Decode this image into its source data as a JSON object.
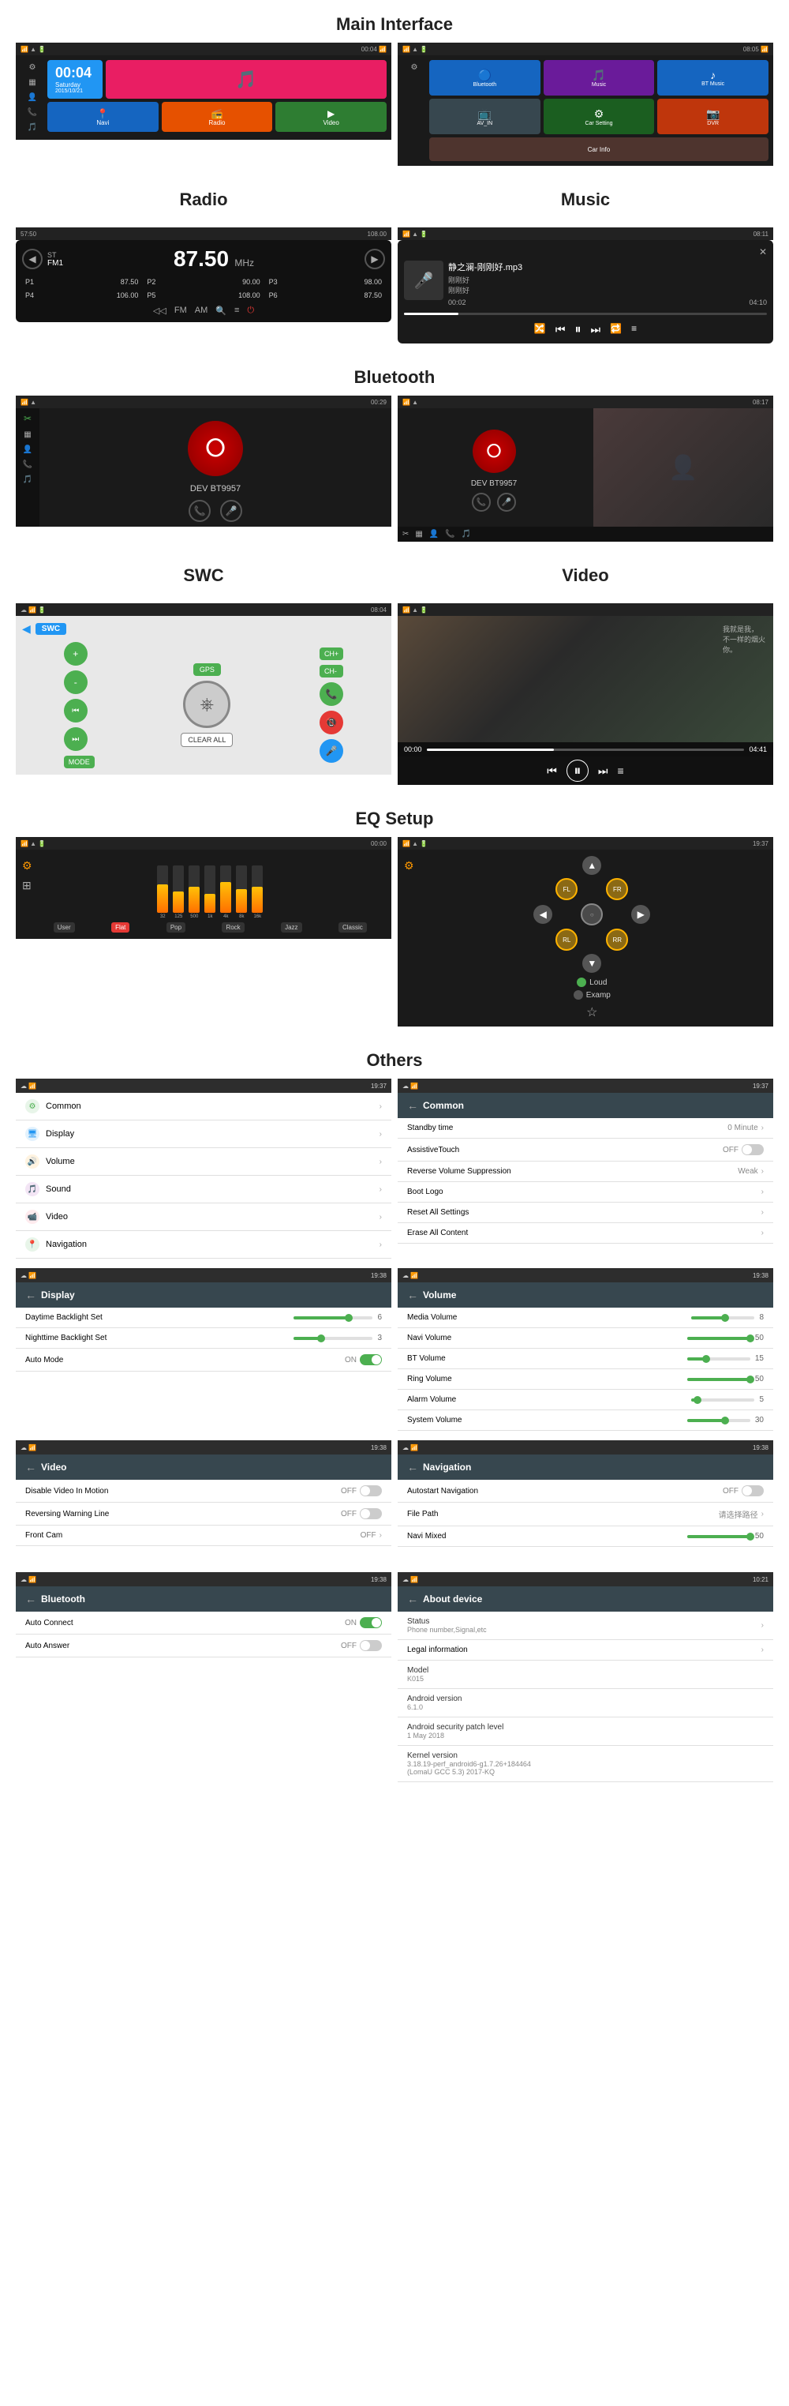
{
  "page": {
    "sections": [
      {
        "id": "main-interface",
        "title": "Main Interface"
      },
      {
        "id": "radio-music",
        "title1": "Radio",
        "title2": "Music"
      },
      {
        "id": "bluetooth",
        "title": "Bluetooth"
      },
      {
        "id": "swc-video",
        "title1": "SWC",
        "title2": "Video"
      },
      {
        "id": "eq-setup",
        "title": "EQ Setup"
      },
      {
        "id": "others",
        "title": "Others"
      }
    ]
  },
  "mainInterface": {
    "left": {
      "time": "00:04",
      "day": "Saturday",
      "date": "2015/10/21",
      "tiles": [
        {
          "label": "Navi",
          "color": "#1565C0",
          "icon": "📍"
        },
        {
          "label": "Radio",
          "color": "#E65100",
          "icon": "📻"
        },
        {
          "label": "",
          "color": "#6A1B9A",
          "icon": "🎵"
        },
        {
          "label": "Video",
          "color": "#2E7D32",
          "icon": "▶"
        }
      ]
    },
    "right": {
      "tiles": [
        {
          "label": "Bluetooth",
          "color": "#1565C0",
          "icon": "🔵"
        },
        {
          "label": "Music",
          "color": "#6A1B9A",
          "icon": "🎵"
        },
        {
          "label": "BT Music",
          "color": "#1565C0",
          "icon": "♪"
        },
        {
          "label": "AV_IN",
          "color": "#37474F",
          "icon": "📺"
        },
        {
          "label": "Car Setting",
          "color": "#1B5E20",
          "icon": "⚙"
        },
        {
          "label": "DVR",
          "color": "#BF360C",
          "icon": "📷"
        },
        {
          "label": "Car Info",
          "color": "#4E342E",
          "icon": "ℹ"
        }
      ]
    }
  },
  "radio": {
    "mode": "ST",
    "tuner": "FM1",
    "frequency": "87.50",
    "unit": "MHz",
    "range": "108.00",
    "presets": [
      {
        "slot": "P1",
        "freq": "87.50"
      },
      {
        "slot": "P2",
        "freq": "90.00"
      },
      {
        "slot": "P3",
        "freq": "98.00"
      },
      {
        "slot": "P4",
        "freq": "106.00"
      },
      {
        "slot": "P5",
        "freq": "108.00"
      },
      {
        "slot": "P6",
        "freq": "87.50"
      }
    ],
    "modes": [
      "FM",
      "AM",
      "Q",
      "EQ"
    ]
  },
  "music": {
    "title": "静之澜-刚刚好.mp3",
    "artist": "刚刚好",
    "album": "刚刚好",
    "timeElapsed": "00:02",
    "timeTotal": "04:10",
    "icon": "🎤"
  },
  "bluetooth": {
    "left": {
      "device": "DEV BT9957",
      "status": "Connected"
    },
    "right": {
      "device": "DEV BT9957",
      "status": "Connected"
    }
  },
  "swc": {
    "title": "SWC",
    "gpsLabel": "GPS",
    "clearAllLabel": "CLEAR ALL",
    "channelUp": "CH+",
    "channelDown": "CH-",
    "modeLabel": "MODE"
  },
  "video": {
    "timeElapsed": "00:00",
    "timeTotal": "04:41"
  },
  "eq": {
    "bars": [
      {
        "label": "32",
        "height": 60
      },
      {
        "label": "125",
        "height": 45
      },
      {
        "label": "500",
        "height": 55
      },
      {
        "label": "1k",
        "height": 40
      },
      {
        "label": "4k",
        "height": 65
      },
      {
        "label": "8k",
        "height": 50
      },
      {
        "label": "16k",
        "height": 55
      }
    ],
    "presets": [
      "User",
      "Flat",
      "Pop",
      "Rock",
      "Jazz",
      "Classic"
    ],
    "activePreset": "Flat",
    "rightOptions": [
      {
        "label": "Loud",
        "active": true
      },
      {
        "label": "Examp",
        "active": false
      }
    ]
  },
  "settings": {
    "mainItems": [
      {
        "icon": "⚙",
        "iconColor": "#4CAF50",
        "label": "Common"
      },
      {
        "icon": "🖥",
        "iconColor": "#2196F3",
        "label": "Display"
      },
      {
        "icon": "🔊",
        "iconColor": "#FF9800",
        "label": "Volume"
      },
      {
        "icon": "🎵",
        "iconColor": "#9C27B0",
        "label": "Sound"
      },
      {
        "icon": "📹",
        "iconColor": "#F44336",
        "label": "Video"
      },
      {
        "icon": "📍",
        "iconColor": "#4CAF50",
        "label": "Navigation"
      }
    ],
    "common": {
      "title": "Common",
      "items": [
        {
          "label": "Standby time",
          "value": "0 Minute",
          "type": "value-arrow"
        },
        {
          "label": "AssistiveTouch",
          "value": "OFF",
          "type": "toggle-off"
        },
        {
          "label": "Reverse Volume Suppression",
          "value": "Weak",
          "type": "value-arrow"
        },
        {
          "label": "Boot Logo",
          "value": "",
          "type": "arrow"
        },
        {
          "label": "Reset All Settings",
          "value": "",
          "type": "arrow"
        },
        {
          "label": "Erase All Content",
          "value": "",
          "type": "arrow"
        }
      ]
    },
    "display": {
      "title": "Display",
      "items": [
        {
          "label": "Daytime Backlight Set",
          "value": "6",
          "sliderPercent": 70,
          "type": "slider"
        },
        {
          "label": "Nighttime Backlight Set",
          "value": "3",
          "sliderPercent": 35,
          "type": "slider"
        },
        {
          "label": "Auto Mode",
          "value": "ON",
          "type": "toggle-on"
        }
      ]
    },
    "volume": {
      "title": "Volume",
      "items": [
        {
          "label": "Media Volume",
          "value": "8",
          "sliderPercent": 53,
          "type": "slider"
        },
        {
          "label": "Navi Volume",
          "value": "50",
          "sliderPercent": 100,
          "type": "slider"
        },
        {
          "label": "BT Volume",
          "value": "15",
          "sliderPercent": 30,
          "type": "slider"
        },
        {
          "label": "Ring Volume",
          "value": "50",
          "sliderPercent": 100,
          "type": "slider"
        },
        {
          "label": "Alarm Volume",
          "value": "5",
          "sliderPercent": 10,
          "type": "slider"
        },
        {
          "label": "System Volume",
          "value": "30",
          "sliderPercent": 60,
          "type": "slider"
        }
      ]
    },
    "video": {
      "title": "Video",
      "items": [
        {
          "label": "Disable Video In Motion",
          "value": "OFF",
          "type": "toggle-off"
        },
        {
          "label": "Reversing Warning Line",
          "value": "OFF",
          "type": "toggle-off"
        },
        {
          "label": "Front Cam",
          "value": "OFF",
          "type": "toggle-off-arrow"
        }
      ]
    },
    "navigation": {
      "title": "Navigation",
      "items": [
        {
          "label": "Autostart Navigation",
          "value": "OFF",
          "type": "toggle-off"
        },
        {
          "label": "File Path",
          "value": "请选择路径",
          "type": "value-arrow"
        },
        {
          "label": "Navi Mixed",
          "value": "50",
          "sliderPercent": 100,
          "type": "slider"
        }
      ]
    },
    "bluetooth": {
      "title": "Bluetooth",
      "items": [
        {
          "label": "Auto Connect",
          "value": "ON",
          "type": "toggle-on"
        },
        {
          "label": "Auto Answer",
          "value": "OFF",
          "type": "toggle-off"
        }
      ]
    },
    "aboutDevice": {
      "title": "About device",
      "items": [
        {
          "label": "Status",
          "value": "Phone number,Signal,etc"
        },
        {
          "label": "Legal information",
          "value": ""
        },
        {
          "label": "Model",
          "value": "K015"
        },
        {
          "label": "Android version",
          "value": "6.1.0"
        },
        {
          "label": "Android security patch level",
          "value": "1 May 2018"
        },
        {
          "label": "Kernel version",
          "value": "3.18.19-perf_android6-g1.7.26+184464 (LomaU GCC 5.3) 2017-KQ"
        }
      ]
    }
  },
  "statusBar": {
    "left": "9:37",
    "icons": "▲ WiFi Batt"
  }
}
